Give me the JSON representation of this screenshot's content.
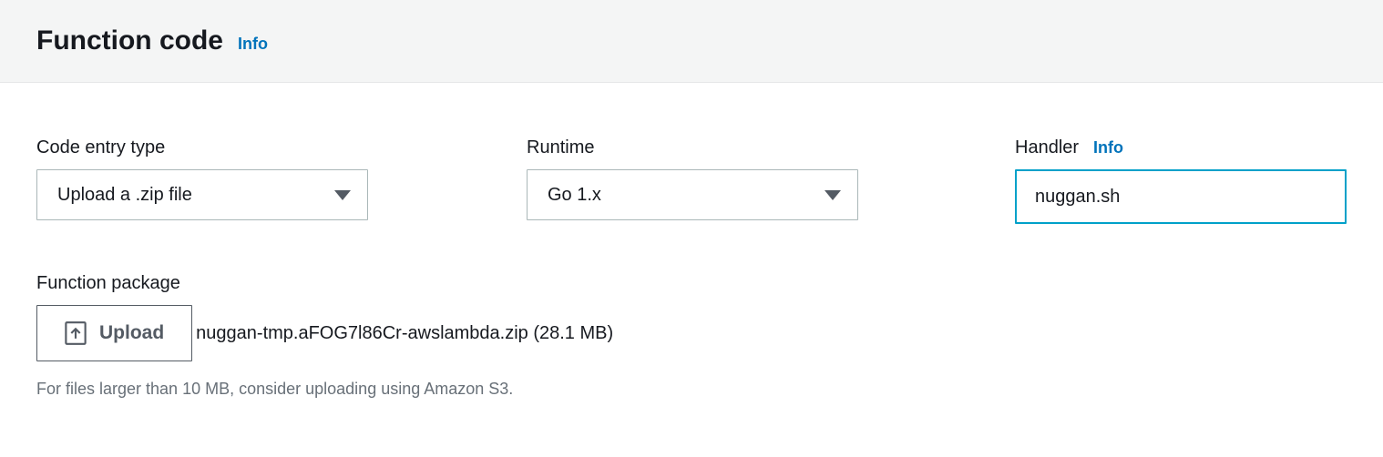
{
  "header": {
    "title": "Function code",
    "info_link": "Info"
  },
  "code_entry": {
    "label": "Code entry type",
    "selected": "Upload a .zip file"
  },
  "runtime": {
    "label": "Runtime",
    "selected": "Go 1.x"
  },
  "handler": {
    "label": "Handler",
    "info_link": "Info",
    "value": "nuggan.sh"
  },
  "function_package": {
    "label": "Function package",
    "upload_button": "Upload",
    "filename": "nuggan-tmp.aFOG7l86Cr-awslambda.zip (28.1 MB)",
    "hint": "For files larger than 10 MB, consider uploading using Amazon S3."
  }
}
